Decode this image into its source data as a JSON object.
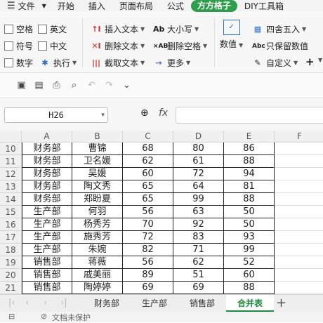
{
  "menubar": {
    "file_label": "文件",
    "items": [
      "开始",
      "插入",
      "页面布局",
      "公式",
      "方方格子",
      "DIY工具箱"
    ],
    "active_index": 4
  },
  "ribbon": {
    "checkboxes": [
      "空格",
      "英文",
      "符号",
      "中文",
      "数字"
    ],
    "execute_label": "执行",
    "insert_text": "插入文本",
    "delete_text": "删除文本",
    "extract_text": "截取文本",
    "case_label": "大小写",
    "delete_space": "删除空格",
    "more_label": "更多",
    "number_label": "数值",
    "round_label": "四舍五入",
    "keep_value": "只保留数值",
    "custom_label": "自定义"
  },
  "formula_bar": {
    "name_box": "H26",
    "fx": "fx",
    "formula": ""
  },
  "columns": [
    "A",
    "B",
    "C",
    "D",
    "E",
    "F"
  ],
  "rows": [
    {
      "n": "10",
      "a": "财务部",
      "b": "曹锦",
      "c": "68",
      "d": "80",
      "e": "86"
    },
    {
      "n": "11",
      "a": "财务部",
      "b": "卫名媛",
      "c": "62",
      "d": "61",
      "e": "88"
    },
    {
      "n": "12",
      "a": "财务部",
      "b": "吴媛",
      "c": "60",
      "d": "72",
      "e": "94"
    },
    {
      "n": "13",
      "a": "财务部",
      "b": "陶文秀",
      "c": "65",
      "d": "64",
      "e": "81"
    },
    {
      "n": "14",
      "a": "财务部",
      "b": "郑盼夏",
      "c": "65",
      "d": "99",
      "e": "88"
    },
    {
      "n": "15",
      "a": "生产部",
      "b": "何羽",
      "c": "56",
      "d": "63",
      "e": "50"
    },
    {
      "n": "16",
      "a": "生产部",
      "b": "杨秀芳",
      "c": "70",
      "d": "92",
      "e": "50"
    },
    {
      "n": "17",
      "a": "生产部",
      "b": "施秀芳",
      "c": "72",
      "d": "83",
      "e": "93"
    },
    {
      "n": "18",
      "a": "生产部",
      "b": "朱婉",
      "c": "82",
      "d": "71",
      "e": "99"
    },
    {
      "n": "19",
      "a": "销售部",
      "b": "蒋薇",
      "c": "56",
      "d": "62",
      "e": "52"
    },
    {
      "n": "20",
      "a": "销售部",
      "b": "戚美丽",
      "c": "89",
      "d": "51",
      "e": "60"
    },
    {
      "n": "21",
      "a": "销售部",
      "b": "陶婷婷",
      "c": "69",
      "d": "69",
      "e": "88"
    }
  ],
  "sheet_tabs": [
    "财务部",
    "生产部",
    "销售部",
    "合并表"
  ],
  "active_sheet": 3,
  "status": {
    "protect": "文档未保护"
  },
  "colors": {
    "accent": "#2d9f4a"
  }
}
